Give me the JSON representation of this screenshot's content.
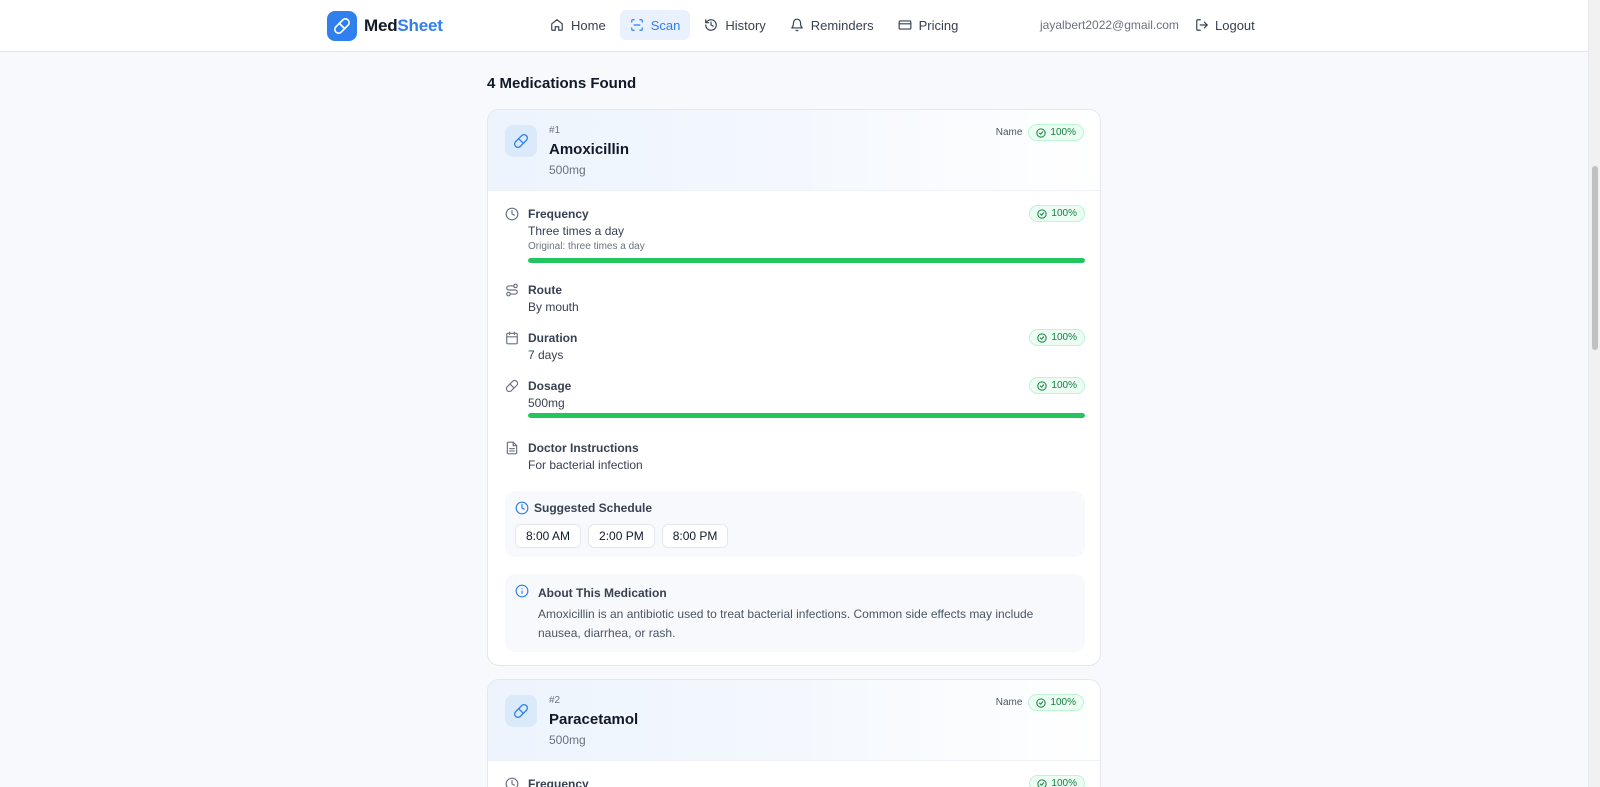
{
  "app": {
    "name_part1": "Med",
    "name_part2": "Sheet"
  },
  "nav": {
    "items": [
      {
        "label": "Home",
        "icon": "home-icon",
        "active": false
      },
      {
        "label": "Scan",
        "icon": "scan-icon",
        "active": true
      },
      {
        "label": "History",
        "icon": "history-icon",
        "active": false
      },
      {
        "label": "Reminders",
        "icon": "bell-icon",
        "active": false
      },
      {
        "label": "Pricing",
        "icon": "credit-card-icon",
        "active": false
      }
    ],
    "user_email": "jayalbert2022@gmail.com",
    "logout_label": "Logout"
  },
  "results": {
    "title": "4 Medications Found",
    "medications": [
      {
        "index": "#1",
        "name": "Amoxicillin",
        "strength": "500mg",
        "name_label": "Name",
        "name_confidence": "100%",
        "frequency": {
          "label": "Frequency",
          "value": "Three times a day",
          "original": "Original: three times a day",
          "confidence": "100%",
          "confidence_fraction": 1.0
        },
        "route": {
          "label": "Route",
          "value": "By mouth"
        },
        "duration": {
          "label": "Duration",
          "value": "7 days",
          "confidence": "100%"
        },
        "dosage": {
          "label": "Dosage",
          "value": "500mg",
          "confidence": "100%",
          "confidence_fraction": 1.0
        },
        "instructions": {
          "label": "Doctor Instructions",
          "value": "For bacterial infection"
        },
        "schedule": {
          "title": "Suggested Schedule",
          "times": [
            "8:00 AM",
            "2:00 PM",
            "8:00 PM"
          ]
        },
        "about": {
          "title": "About This Medication",
          "text": "Amoxicillin is an antibiotic used to treat bacterial infections. Common side effects may include nausea, diarrhea, or rash."
        }
      },
      {
        "index": "#2",
        "name": "Paracetamol",
        "strength": "500mg",
        "name_label": "Name",
        "name_confidence": "100%",
        "frequency": {
          "label": "Frequency",
          "confidence": "100%"
        }
      }
    ]
  },
  "colors": {
    "accent": "#2f80ed",
    "success": "#22c55e",
    "background": "#f7f9fc"
  }
}
